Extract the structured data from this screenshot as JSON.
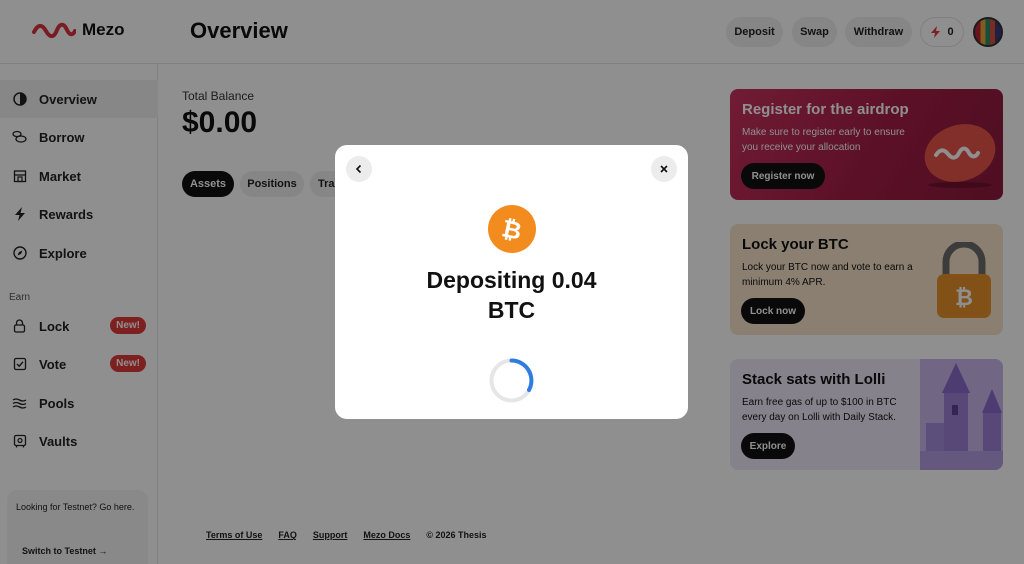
{
  "app": {
    "brand": "Mezo",
    "page_title": "Overview"
  },
  "header": {
    "deposit_label": "Deposit",
    "swap_label": "Swap",
    "withdraw_label": "Withdraw",
    "points_count": "0"
  },
  "sidebar": {
    "items": [
      {
        "label": "Overview",
        "icon": "overview-icon",
        "active": true
      },
      {
        "label": "Borrow",
        "icon": "coins-icon"
      },
      {
        "label": "Market",
        "icon": "store-icon"
      },
      {
        "label": "Rewards",
        "icon": "bolt-icon"
      },
      {
        "label": "Explore",
        "icon": "compass-icon"
      }
    ],
    "earn_label": "Earn",
    "earn_items": [
      {
        "label": "Lock",
        "icon": "lock-icon",
        "badge": "New!"
      },
      {
        "label": "Vote",
        "icon": "checkbox-icon",
        "badge": "New!"
      },
      {
        "label": "Pools",
        "icon": "waves-icon"
      },
      {
        "label": "Vaults",
        "icon": "vault-icon"
      }
    ],
    "testnet_text": "Looking for Testnet? Go here.",
    "testnet_link": "Switch to Testnet →"
  },
  "main": {
    "total_label": "Total Balance",
    "total_value": "$0.00",
    "tabs": [
      "Assets",
      "Positions",
      "Tra"
    ]
  },
  "promos": {
    "airdrop": {
      "title": "Register for the airdrop",
      "body": "Make sure to register early to ensure you receive your allocation",
      "button": "Register now"
    },
    "lock": {
      "title": "Lock your BTC",
      "body": "Lock your BTC now and vote to earn a minimum 4% APR.",
      "button": "Lock now"
    },
    "lolli": {
      "title": "Stack sats with Lolli",
      "body": "Earn free gas of up to $100 in BTC every day on Lolli with Daily Stack.",
      "button": "Explore"
    }
  },
  "footer": {
    "links": [
      "Terms of Use",
      "FAQ",
      "Support",
      "Mezo Docs"
    ],
    "copyright": "© 2026 Thesis"
  },
  "modal": {
    "title_line1": "Depositing 0.04",
    "title_line2": "BTC",
    "back_icon": "chevron-left-icon",
    "close_icon": "close-icon",
    "coin_icon": "bitcoin-icon"
  },
  "colors": {
    "accent_red": "#e03a3a",
    "airdrop_bg": "#a31d47",
    "lock_bg": "#f6e3c8",
    "lolli_bg": "#efe8f8",
    "bitcoin_orange": "#f28c1e",
    "spinner_blue": "#2f7de1"
  }
}
